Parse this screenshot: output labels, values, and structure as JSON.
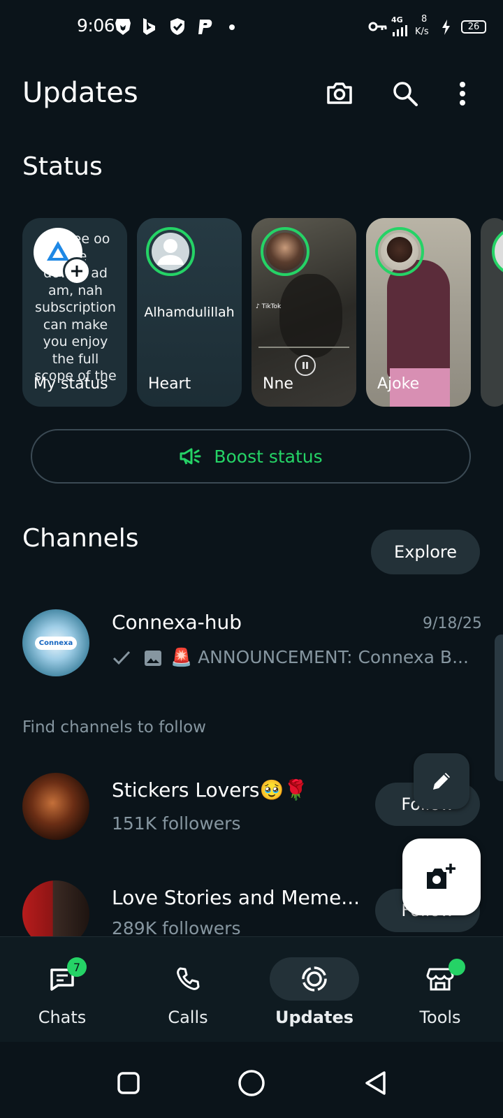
{
  "status_bar": {
    "time": "9:06",
    "network": "4G",
    "speed_value": "8",
    "speed_unit": "K/s",
    "battery": "26"
  },
  "header": {
    "title": "Updates"
  },
  "status": {
    "section_title": "Status",
    "my_status_preview": "Na free oo like download am, nah subscription can make you enjoy the full scope of the",
    "cards": [
      {
        "name": "My status"
      },
      {
        "name": "Heart",
        "text": "Alhamdulillah"
      },
      {
        "name": "Nne"
      },
      {
        "name": "Ajoke"
      }
    ],
    "boost_label": "Boost status"
  },
  "channels": {
    "section_title": "Channels",
    "explore_label": "Explore",
    "followed": {
      "name": "Connexa-hub",
      "date": "9/18/25",
      "preview": "🚨 ANNOUNCEMENT: Connexa B...",
      "avatar_text": "Connexa"
    },
    "find_label": "Find channels to follow",
    "suggestions": [
      {
        "name": "Stickers Lovers🥹🌹",
        "followers": "151K followers",
        "button": "Follow"
      },
      {
        "name": "Love Stories and Meme...",
        "followers": "289K followers",
        "button": "Follow"
      }
    ]
  },
  "nav": {
    "items": [
      {
        "label": "Chats",
        "badge": "7"
      },
      {
        "label": "Calls"
      },
      {
        "label": "Updates"
      },
      {
        "label": "Tools"
      }
    ]
  },
  "colors": {
    "background": "#0b141a",
    "accent": "#25d366",
    "surface": "#233138"
  }
}
